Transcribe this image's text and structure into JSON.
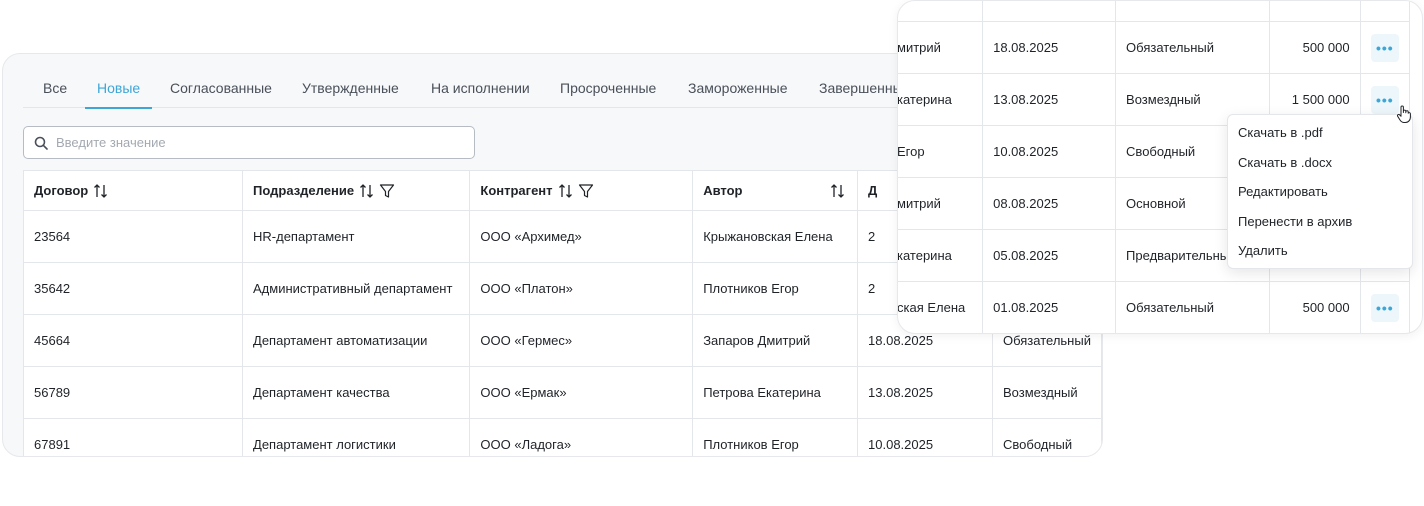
{
  "tabs": [
    {
      "label": "Все",
      "active": false
    },
    {
      "label": "Новые",
      "active": true
    },
    {
      "label": "Согласованные",
      "active": false
    },
    {
      "label": "Утвержденные",
      "active": false
    },
    {
      "label": "На исполнении",
      "active": false
    },
    {
      "label": "Просроченные",
      "active": false
    },
    {
      "label": "Замороженные",
      "active": false
    },
    {
      "label": "Завершенные",
      "active": false
    }
  ],
  "search": {
    "placeholder": "Введите значение",
    "value": ""
  },
  "table": {
    "headers": [
      "Договор",
      "Подразделение",
      "Контрагент",
      "Автор",
      "Д",
      ""
    ],
    "rows": [
      [
        "23564",
        "HR-департамент",
        "ООО «Архимед»",
        "Крыжановская Елена",
        "2",
        ""
      ],
      [
        "35642",
        "Административный департамент",
        "ООО «Платон»",
        "Плотников Егор",
        "2",
        ""
      ],
      [
        "45664",
        "Департамент автоматизации",
        "ООО «Гермес»",
        "Запаров Дмитрий",
        "18.08.2025",
        "Обязательный"
      ],
      [
        "56789",
        "Департамент качества",
        "ООО «Ермак»",
        "Петрова Екатерина",
        "13.08.2025",
        "Возмездный"
      ],
      [
        "67891",
        "Департамент логистики",
        "ООО «Ладога»",
        "Плотников Егор",
        "10.08.2025",
        "Свободный"
      ]
    ]
  },
  "front_table": {
    "rows": [
      [
        "митрий",
        "18.08.2025",
        "Обязательный",
        "500 000"
      ],
      [
        "катерина",
        "13.08.2025",
        "Возмездный",
        "1 500 000"
      ],
      [
        "Егор",
        "10.08.2025",
        "Свободный",
        ""
      ],
      [
        "митрий",
        "08.08.2025",
        "Основной",
        ""
      ],
      [
        "катерина",
        "05.08.2025",
        "Предварительный",
        ""
      ],
      [
        "ская Елена",
        "01.08.2025",
        "Обязательный",
        "500 000"
      ]
    ],
    "more_label": "•••"
  },
  "dropdown": {
    "items": [
      "Скачать в .pdf",
      "Скачать в .docx",
      "Редактировать",
      "Перенести в архив",
      "Удалить"
    ]
  },
  "colors": {
    "accent": "#3ea6d6",
    "border": "#e3e6ea",
    "panel_bg": "#f7f8fa"
  }
}
